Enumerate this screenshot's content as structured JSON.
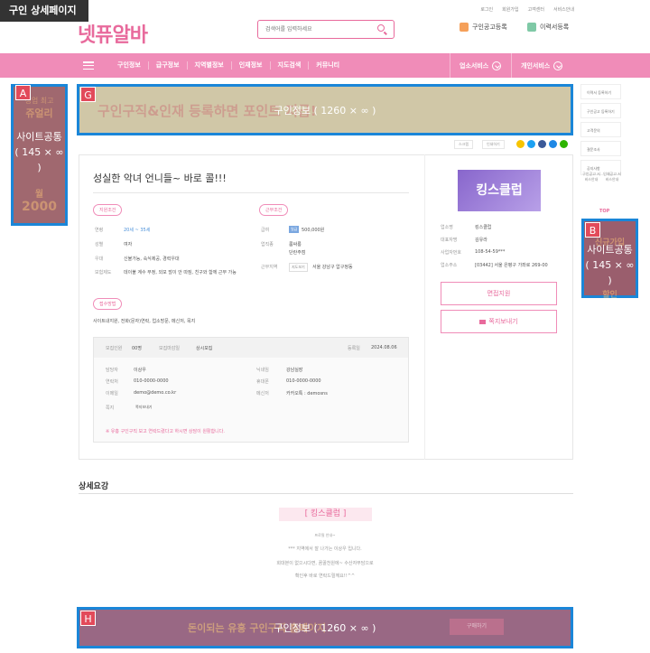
{
  "page_tag": "구인 상세페이지",
  "header": {
    "logo_text": "넷퓨알바",
    "search_placeholder": "검색어를 입력하세요",
    "top_links": [
      "로그인",
      "회원가입",
      "고객센터",
      "서비스안내"
    ],
    "post_job_label": "구인공고등록",
    "resume_label": "이력서등록"
  },
  "nav": {
    "items": [
      "구인정보",
      "급구정보",
      "지역별정보",
      "인재정보",
      "지도검색",
      "커뮤니티"
    ],
    "business_service": "업소서비스",
    "personal_service": "개인서비스"
  },
  "overlays": {
    "a": {
      "badge": "A",
      "title": "사이트공통",
      "size": "( 145 × ∞ )"
    },
    "b": {
      "badge": "B",
      "title": "사이트공통",
      "size": "( 145 × ∞ )"
    },
    "g": {
      "badge": "G",
      "title": "구인정보",
      "size": "( 1260 × ∞ )"
    },
    "h": {
      "badge": "H",
      "title": "구인정보",
      "size": "( 1260 × ∞ )"
    }
  },
  "banner_g_bg": "구인구직&인재 등록하면 포인트 지급!",
  "banner_h_bg": "돈이되는 유흥 구인구직 홈페이지",
  "banner_h_btn": "구매하기",
  "banner_a_bg": [
    "성업 최고",
    "쥬얼리",
    "월",
    "2000"
  ],
  "banner_b_bg": [
    "신규가입",
    "할인"
  ],
  "toolbar": {
    "scrap": "스크랩",
    "print": "인쇄하기"
  },
  "job": {
    "title": "성실한 악녀 언니들~ 바로 콜!!!",
    "qual_label": "지원조건",
    "work_label": "근무조건",
    "age_k": "연령",
    "age_v": "20세 ~ 35세",
    "gender_k": "성별",
    "gender_v": "여자",
    "pref_k": "우대",
    "pref_v": "신불가능, 숙식제공, 경력우대",
    "welfare_k": "보험제도",
    "welfare_v": "데이불 계수 부정, 외모 많이 안 따짐, 친구와 함께 근무 가능",
    "pay_k": "급여",
    "pay_badge": "일급",
    "pay_v": "500,000원",
    "jobtype_k": "업직종",
    "jobtype_v1": "룸싸롱",
    "jobtype_v2": "단란주점",
    "loc_k": "근무지역",
    "loc_btn": "지도보기",
    "loc_v": "서울 강남구 압구정동",
    "apply_label": "접수방법",
    "apply_v": "사이트내지원, 전화(문자)연락, 업소방문, 메신저, 목지",
    "recruit_k": "모집인원",
    "recruit_v": "00명",
    "deadline_k": "모집마감일",
    "deadline_v": "상시모집",
    "reg_k": "등록일",
    "reg_v": "2024.08.06",
    "manager_k": "담당자",
    "manager_v": "이상우",
    "nick_k": "닉네임",
    "nick_v": "강남실장",
    "contact_k": "연락처",
    "contact_v": "010-0000-0000",
    "mobile_k": "휴대폰",
    "mobile_v": "010-0000-0000",
    "email_k": "이메일",
    "email_v": "demo@demo.co.kr",
    "messenger_k": "메신저",
    "messenger_v": "카카오톡 : demosns",
    "note_k": "쪽지",
    "note_btn": "쪽지보내기",
    "warning": "※ 유흥 구인구직 보고 연락드렸다고 하시면 상담이 원활합니다."
  },
  "company": {
    "logo_text": "킹스클럽",
    "name_k": "업소명",
    "name_v": "킹스클럽",
    "ceo_k": "대표자명",
    "ceo_v": "김유라",
    "bizno_k": "사업자번호",
    "bizno_v": "108-54-59***",
    "addr_k": "업소주소",
    "addr_v": "[03442] 서울 은평구 가좌로 269-00",
    "apply_btn": "면접지원",
    "msg_btn": "쪽지보내기"
  },
  "sidebar": {
    "items": [
      "이력서 등록하기",
      "구인공고 등록하기",
      "고객문의",
      "결문조사",
      "공지사항"
    ],
    "guide1": "구인공고 서비스안내",
    "guide2": "인재공고 서비스안내",
    "top": "TOP"
  },
  "detail": {
    "title": "상세요강",
    "bracket": "[ 킹스클럽 ]",
    "line1": "프로필 안내~",
    "line2": "*** 지역에서 잘 나가는 이상우 입니다.",
    "line3": "회대뵨이 없으시다면, 꿈꿀천원에~ 수산자부담으로",
    "line4": "확인후 바로 연락드릴께요!!^^"
  },
  "colors": {
    "accent": "#f08cb8",
    "overlay_border": "#1a86d8",
    "badge": "#e24a5a"
  }
}
